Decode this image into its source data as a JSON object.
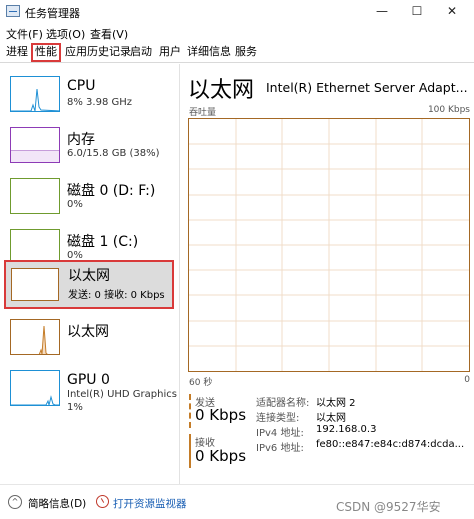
{
  "window": {
    "title": "任务管理器",
    "min_glyph": "—",
    "max_glyph": "☐",
    "close_glyph": "✕"
  },
  "menu": {
    "file": "文件(F)",
    "options": "选项(O)",
    "view": "查看(V)"
  },
  "tabs": {
    "process": "进程",
    "performance": "性能",
    "app_history": "应用历史记录",
    "startup": "启动",
    "users": "用户",
    "details": "详细信息",
    "services": "服务"
  },
  "sidebar": {
    "cpu": {
      "title": "CPU",
      "sub": "8%  3.98 GHz"
    },
    "memory": {
      "title": "内存",
      "sub": "6.0/15.8 GB (38%)"
    },
    "disk0": {
      "title": "磁盘 0 (D: F:)",
      "sub": "0%"
    },
    "disk1": {
      "title": "磁盘 1 (C:)",
      "sub": "0%"
    },
    "eth0": {
      "title": "以太网",
      "sub": "发送: 0 接收: 0 Kbps"
    },
    "eth1": {
      "title": "以太网",
      "sub": ""
    },
    "gpu": {
      "title": "GPU 0",
      "sub1": "Intel(R) UHD Graphics",
      "sub2": "1%"
    }
  },
  "main": {
    "heading": "以太网",
    "adapter": "Intel(R) Ethernet Server Adapt...",
    "throughput_label": "吞吐量",
    "max_label": "100 Kbps",
    "time_label": "60 秒",
    "zero_label": "0",
    "send_label": "发送",
    "send_value": "0 Kbps",
    "recv_label": "接收",
    "recv_value": "0 Kbps",
    "props": [
      {
        "k": "适配器名称:",
        "v": "以太网 2"
      },
      {
        "k": "连接类型:",
        "v": "以太网"
      },
      {
        "k": "IPv4 地址:",
        "v": "192.168.0.3"
      },
      {
        "k": "IPv6 地址:",
        "v": "fe80::e847:e84c:d874:dcda..."
      }
    ]
  },
  "footer": {
    "collapse_glyph": "^",
    "collapse": "简略信息(D)",
    "monitor": "打开资源监视器",
    "watermark": "CSDN @9527华安"
  },
  "colors": {
    "cpu": "#1e90d5",
    "memory": "#8d3bb6",
    "disk": "#6f9b2e",
    "ethernet": "#a46824",
    "highlight": "#d93a3a",
    "link": "#1a5fb4"
  }
}
